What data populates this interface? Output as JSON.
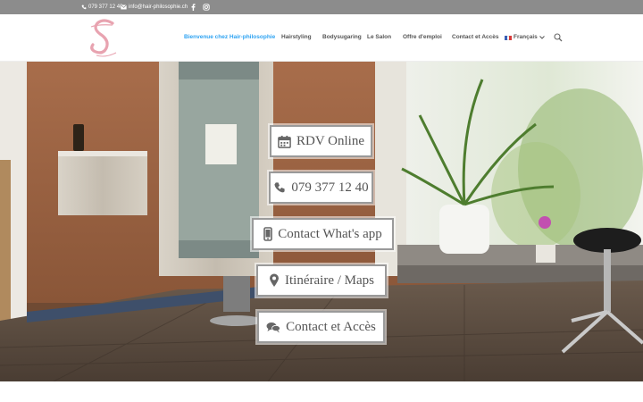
{
  "topbar": {
    "phone": "079 377 12 40",
    "email": "info@hair-philosophie.ch",
    "icons": [
      "phone-icon",
      "envelope-icon",
      "facebook-icon",
      "instagram-icon"
    ]
  },
  "logo": {
    "letter": "S",
    "color": "#e8a3b0"
  },
  "nav": {
    "items": [
      {
        "label": "Bienvenue chez Hair-philosophie",
        "active": true
      },
      {
        "label": "Hairstyling"
      },
      {
        "label": "Bodysugaring"
      },
      {
        "label": "Le Salon"
      },
      {
        "label": "Offre d'emploi"
      },
      {
        "label": "Contact et Accès"
      }
    ],
    "language": "Français",
    "active_color": "#2ea3f2",
    "icons": [
      "flag-france-icon",
      "chevron-down-icon",
      "search-icon"
    ]
  },
  "hero": {
    "buttons": [
      {
        "label": "RDV Online",
        "icon": "calendar-icon"
      },
      {
        "label": "079 377 12 40",
        "icon": "phone-icon"
      },
      {
        "label": "Contact What's app",
        "icon": "mobile-phone-icon"
      },
      {
        "label": "Itinéraire / Maps",
        "icon": "map-marker-icon"
      },
      {
        "label": "Contact et Accès",
        "icon": "chat-bubbles-icon"
      }
    ]
  }
}
